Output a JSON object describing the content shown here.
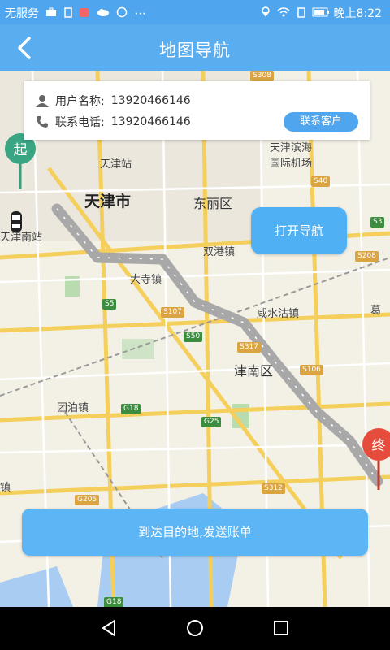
{
  "status_bar": {
    "carrier": "无服务",
    "time": "晚上8:22"
  },
  "header": {
    "title": "地图导航"
  },
  "info_card": {
    "username_label": "用户名称:",
    "username_value": "13920466146",
    "phone_label": "联系电话:",
    "phone_value": "13920466146",
    "contact_button": "联系客户"
  },
  "map": {
    "start_marker": "起",
    "end_marker": "终",
    "labels": {
      "tianjin_city": "天津市",
      "dongli": "东丽区",
      "jinnan": "津南区",
      "tianjin_station": "天津站",
      "tianjin_south": "天津南站",
      "airport_line1": "天津滨海",
      "airport_line2": "国际机场",
      "shuanggang": "双港镇",
      "dasi": "大寺镇",
      "xianshuigu": "咸水沽镇",
      "tuanbo": "团泊镇",
      "ge": "葛",
      "zhen": "镇"
    },
    "roads": [
      "S308",
      "S40",
      "S3",
      "S208",
      "S5",
      "S107",
      "S50",
      "S317",
      "S106",
      "G18",
      "G25",
      "S312",
      "G205",
      "G18"
    ]
  },
  "buttons": {
    "open_nav": "打开导航",
    "arrive": "到达目的地,发送账单"
  }
}
